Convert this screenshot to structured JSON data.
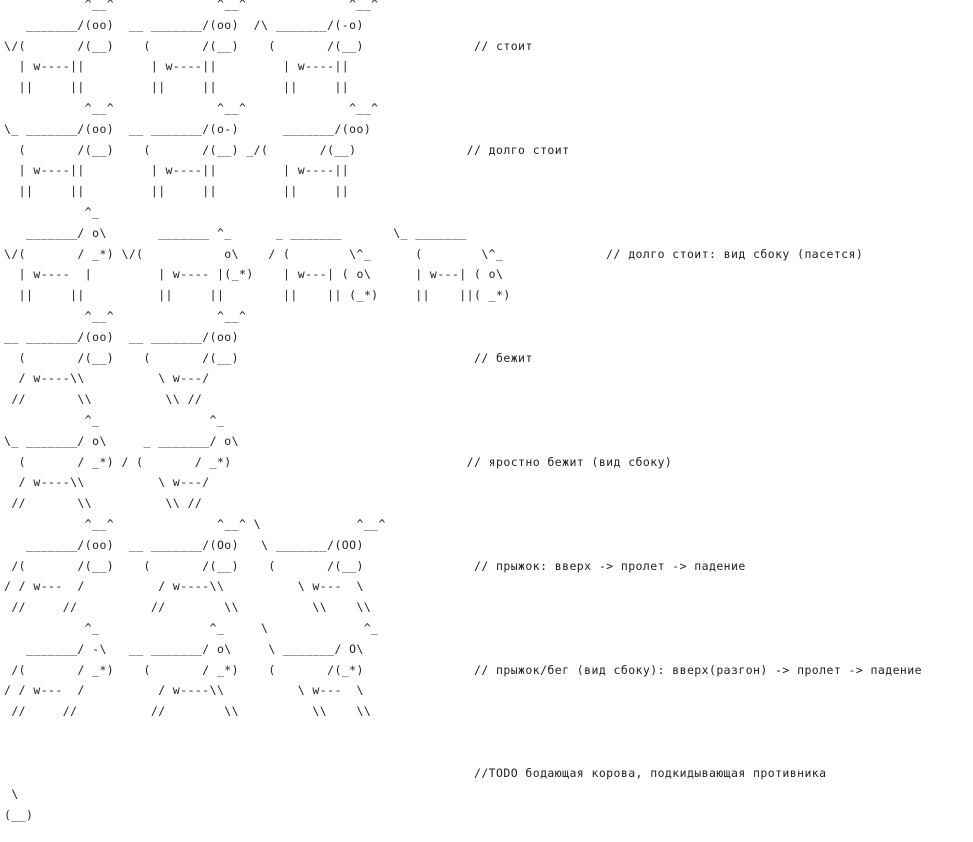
{
  "text_color": "#222222",
  "background_color": "#ffffff",
  "lines": [
    "           ^__^              ^__^              ^__^",
    "   _______/(oo)  __ _______/(oo)  /\\ _______/(-o)",
    "\\/(       /(__)    (       /(__)    (       /(__)               // стоит",
    "  | w----||         | w----||         | w----||",
    "  ||     ||         ||     ||         ||     ||",
    "           ^__^              ^__^              ^__^",
    "\\_ _______/(oo)  __ _______/(o-)      _______/(oo)",
    "  (       /(__)    (       /(__) _/(       /(__)               // долго стоит",
    "  | w----||         | w----||         | w----||",
    "  ||     ||         ||     ||         ||     ||",
    "           ^_",
    "   _______/ o\\       _______ ^_      _ _______       \\_ _______",
    "\\/(       / _*) \\/(           o\\    / (        \\^_      (        \\^_              // долго стоит: вид сбоку (пасется)",
    "  | w----  |         | w---- |(_*)    | w---| ( o\\      | w---| ( o\\",
    "  ||     ||          ||     ||        ||    || (_*)     ||    ||( _*)",
    "           ^__^              ^__^",
    "__ _______/(oo)  __ _______/(oo)",
    "  (       /(__)    (       /(__)                                // бежит",
    "  / w----\\\\          \\ w---/",
    " //       \\\\          \\\\ //",
    "           ^_               ^_",
    "\\_ _______/ o\\     _ _______/ o\\",
    "  (       / _*) / (       / _*)                                // яростно бежит (вид сбоку)",
    "  / w----\\\\          \\ w---/",
    " //       \\\\          \\\\ //",
    "           ^__^              ^__^ \\             ^__^",
    "   _______/(oo)  __ _______/(Oo)   \\ _______/(OO)",
    " /(       /(__)    (       /(__)    (       /(__)               // прыжок: вверх -> пролет -> падение",
    "/ / w---  /          / w----\\\\          \\ w---  \\",
    " //     //          //        \\\\          \\\\    \\\\",
    "           ^_               ^_     \\             ^_",
    "   _______/ -\\   __ _______/ o\\     \\ _______/ O\\",
    " /(       / _*)    (       / _*)    (       /(_*)               // прыжок/бег (вид сбоку): вверх(разгон) -> пролет -> падение",
    "/ / w---  /          / w----\\\\          \\ w---  \\",
    " //     //          //        \\\\          \\\\    \\\\",
    "",
    "",
    "                                                                //TODO бодающая корова, подкидывающая противника",
    " \\",
    "(__)"
  ]
}
